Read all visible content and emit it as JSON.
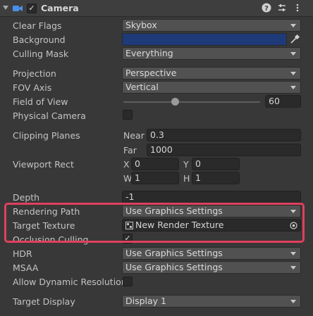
{
  "header": {
    "title": "Camera",
    "enabled_check": "✓",
    "help_icon": "?",
    "settings_icon": "⇵",
    "menu_icon": "⋮"
  },
  "fields": {
    "clear_flags": {
      "label": "Clear Flags",
      "value": "Skybox"
    },
    "background": {
      "label": "Background",
      "color": "#1e3a78"
    },
    "culling_mask": {
      "label": "Culling Mask",
      "value": "Everything"
    },
    "projection": {
      "label": "Projection",
      "value": "Perspective"
    },
    "fov_axis": {
      "label": "FOV Axis",
      "value": "Vertical"
    },
    "field_of_view": {
      "label": "Field of View",
      "value": "60",
      "slider_fraction": 0.38
    },
    "physical_camera": {
      "label": "Physical Camera",
      "checked": false
    },
    "clipping_planes": {
      "label": "Clipping Planes",
      "near_label": "Near",
      "near": "0.3",
      "far_label": "Far",
      "far": "1000"
    },
    "viewport_rect": {
      "label": "Viewport Rect",
      "x_label": "X",
      "x": "0",
      "y_label": "Y",
      "y": "0",
      "w_label": "W",
      "w": "1",
      "h_label": "H",
      "h": "1"
    },
    "depth": {
      "label": "Depth",
      "value": "-1"
    },
    "rendering_path": {
      "label": "Rendering Path",
      "value": "Use Graphics Settings"
    },
    "target_texture": {
      "label": "Target Texture",
      "value": "New Render Texture"
    },
    "occlusion_culling": {
      "label": "Occlusion Culling",
      "check": "✓"
    },
    "hdr": {
      "label": "HDR",
      "value": "Use Graphics Settings"
    },
    "msaa": {
      "label": "MSAA",
      "value": "Use Graphics Settings"
    },
    "allow_dynamic_resolution": {
      "label": "Allow Dynamic Resolution",
      "checked": false
    },
    "target_display": {
      "label": "Target Display",
      "value": "Display 1"
    }
  },
  "colors": {
    "highlight": "#e0405d",
    "accent_icon": "#4a8fe7"
  }
}
